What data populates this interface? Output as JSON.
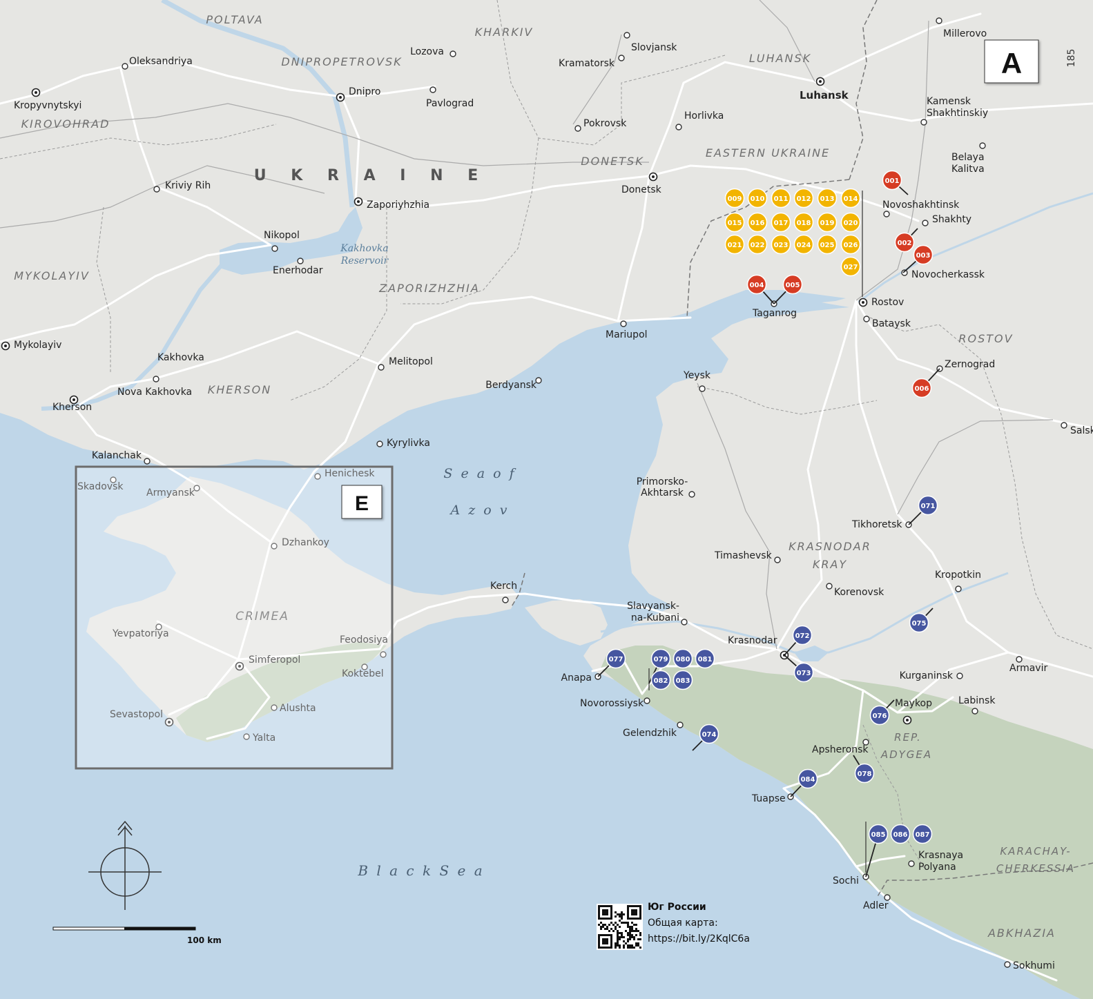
{
  "page_number": "185",
  "map_letter": "A",
  "inset_letter": "E",
  "countries": [
    {
      "id": "ukraine",
      "text": "U K R A I N E"
    }
  ],
  "regions": [
    {
      "id": "poltava",
      "text": "POLTAVA"
    },
    {
      "id": "kharkiv",
      "text": "KHARKIV"
    },
    {
      "id": "dnipropetrovsk",
      "text": "DNIPROPETROVSK"
    },
    {
      "id": "luhansk-region",
      "text": "LUHANSK"
    },
    {
      "id": "kirovohrad",
      "text": "KIROVOHRAD"
    },
    {
      "id": "eastern-ukraine",
      "text": "EASTERN UKRAINE"
    },
    {
      "id": "donetsk-region",
      "text": "DONETSK"
    },
    {
      "id": "mykolayiv-region",
      "text": "MYKOLAYIV"
    },
    {
      "id": "zaporizhzhia-region",
      "text": "ZAPORIZHZHIA"
    },
    {
      "id": "kherson-region",
      "text": "KHERSON"
    },
    {
      "id": "rostov-region",
      "text": "ROSTOV"
    },
    {
      "id": "krasnodar-1",
      "text": "KRASNODAR"
    },
    {
      "id": "krasnodar-2",
      "text": "KRAY"
    },
    {
      "id": "crimea",
      "text": "CRIMEA"
    },
    {
      "id": "adygea-1",
      "text": "REP."
    },
    {
      "id": "adygea-2",
      "text": "ADYGEA"
    },
    {
      "id": "karachay-1",
      "text": "KARACHAY-"
    },
    {
      "id": "karachay-2",
      "text": "CHERKESSIA"
    },
    {
      "id": "abkhazia",
      "text": "ABKHAZIA"
    }
  ],
  "water_labels": [
    {
      "id": "kakhovka-1",
      "text": "Kakhovka"
    },
    {
      "id": "kakhovka-2",
      "text": "Reservoir"
    },
    {
      "id": "azov-1",
      "text": "S e a   o f"
    },
    {
      "id": "azov-2",
      "text": "A z o v"
    },
    {
      "id": "black-sea",
      "text": "B  l  a  c  k     S  e  a"
    }
  ],
  "cities": [
    {
      "id": "millerovo",
      "name": "Millerovo"
    },
    {
      "id": "oleksandriya",
      "name": "Oleksandriya"
    },
    {
      "id": "lozova",
      "name": "Lozova"
    },
    {
      "id": "slovjansk",
      "name": "Slovjansk"
    },
    {
      "id": "kramatorsk",
      "name": "Kramatorsk"
    },
    {
      "id": "kropyvnytskyi",
      "name": "Kropyvnytskyi"
    },
    {
      "id": "dnipro",
      "name": "Dnipro"
    },
    {
      "id": "pavlograd",
      "name": "Pavlograd"
    },
    {
      "id": "luhansk",
      "name": "Luhansk"
    },
    {
      "id": "kamensk-1",
      "name": "Kamensk"
    },
    {
      "id": "kamensk-2",
      "name": "Shakhtinskiy"
    },
    {
      "id": "horlivka",
      "name": "Horlivka"
    },
    {
      "id": "pokrovsk",
      "name": "Pokrovsk"
    },
    {
      "id": "belaya-1",
      "name": "Belaya"
    },
    {
      "id": "belaya-2",
      "name": "Kalitva"
    },
    {
      "id": "kriviy-rih",
      "name": "Kriviy Rih"
    },
    {
      "id": "donetsk",
      "name": "Donetsk"
    },
    {
      "id": "zaporiyhzhia",
      "name": "Zaporiyhzhia"
    },
    {
      "id": "novoshakhtinsk",
      "name": "Novoshakhtinsk"
    },
    {
      "id": "shakhty",
      "name": "Shakhty"
    },
    {
      "id": "nikopol",
      "name": "Nikopol"
    },
    {
      "id": "enerhodar",
      "name": "Enerhodar"
    },
    {
      "id": "novocherkassk",
      "name": "Novocherkassk"
    },
    {
      "id": "taganrog",
      "name": "Taganrog"
    },
    {
      "id": "rostov",
      "name": "Rostov"
    },
    {
      "id": "bataysk",
      "name": "Bataysk"
    },
    {
      "id": "mariupol",
      "name": "Mariupol"
    },
    {
      "id": "mykolayiv",
      "name": "Mykolayiv"
    },
    {
      "id": "kakhovka",
      "name": "Kakhovka"
    },
    {
      "id": "melitopol",
      "name": "Melitopol"
    },
    {
      "id": "zernograd",
      "name": "Zernograd"
    },
    {
      "id": "nova-kakhovka",
      "name": "Nova Kakhovka"
    },
    {
      "id": "berdyansk",
      "name": "Berdyansk"
    },
    {
      "id": "yeysk",
      "name": "Yeysk"
    },
    {
      "id": "kherson",
      "name": "Kherson"
    },
    {
      "id": "salsk",
      "name": "Salsk"
    },
    {
      "id": "kyrylivka",
      "name": "Kyrylivka"
    },
    {
      "id": "kalanchak",
      "name": "Kalanchak"
    },
    {
      "id": "henichesk",
      "name": "Henichesk"
    },
    {
      "id": "skadovsk",
      "name": "Skadovsk"
    },
    {
      "id": "primorsko-1",
      "name": "Primorsko-"
    },
    {
      "id": "primorsko-2",
      "name": "Akhtarsk"
    },
    {
      "id": "armyansk",
      "name": "Armyansk"
    },
    {
      "id": "tikhoretsk",
      "name": "Tikhoretsk"
    },
    {
      "id": "dzhankoy",
      "name": "Dzhankoy"
    },
    {
      "id": "timashevsk",
      "name": "Timashevsk"
    },
    {
      "id": "kropotkin",
      "name": "Kropotkin"
    },
    {
      "id": "kerch",
      "name": "Kerch"
    },
    {
      "id": "korenovsk",
      "name": "Korenovsk"
    },
    {
      "id": "slavyansk-1",
      "name": "Slavyansk-"
    },
    {
      "id": "slavyansk-2",
      "name": "na-Kubani"
    },
    {
      "id": "yevpatoriya",
      "name": "Yevpatoriya"
    },
    {
      "id": "feodosiya",
      "name": "Feodosiya"
    },
    {
      "id": "krasnodar",
      "name": "Krasnodar"
    },
    {
      "id": "simferopol",
      "name": "Simferopol"
    },
    {
      "id": "armavir",
      "name": "Armavir"
    },
    {
      "id": "koktebel",
      "name": "Koktebel"
    },
    {
      "id": "anapa",
      "name": "Anapa"
    },
    {
      "id": "kurganinsk",
      "name": "Kurganinsk"
    },
    {
      "id": "labinsk",
      "name": "Labinsk"
    },
    {
      "id": "novorossiysk",
      "name": "Novorossiysk"
    },
    {
      "id": "maykop",
      "name": "Maykop"
    },
    {
      "id": "sevastopol",
      "name": "Sevastopol"
    },
    {
      "id": "alushta",
      "name": "Alushta"
    },
    {
      "id": "gelendzhik",
      "name": "Gelendzhik"
    },
    {
      "id": "yalta",
      "name": "Yalta"
    },
    {
      "id": "apsheronsk",
      "name": "Apsheronsk"
    },
    {
      "id": "tuapse",
      "name": "Tuapse"
    },
    {
      "id": "krasnaya-1",
      "name": "Krasnaya"
    },
    {
      "id": "krasnaya-2",
      "name": "Polyana"
    },
    {
      "id": "sochi",
      "name": "Sochi"
    },
    {
      "id": "adler",
      "name": "Adler"
    },
    {
      "id": "sokhumi",
      "name": "Sokhumi"
    }
  ],
  "markers": {
    "red": [
      "001",
      "002",
      "003",
      "004",
      "005",
      "006"
    ],
    "yellow": [
      "009",
      "010",
      "011",
      "012",
      "013",
      "014",
      "015",
      "016",
      "017",
      "018",
      "019",
      "020",
      "021",
      "022",
      "023",
      "024",
      "025",
      "026",
      "027"
    ],
    "blue": [
      "071",
      "072",
      "073",
      "074",
      "075",
      "076",
      "077",
      "078",
      "079",
      "080",
      "081",
      "082",
      "083",
      "084",
      "085",
      "086",
      "087"
    ]
  },
  "marker_colors": {
    "red": "#d63c24",
    "yellow": "#f2b400",
    "blue": "#4656a0"
  },
  "colors": {
    "sea": "#bfd6e8",
    "land": "#e6e6e3",
    "mountains": "#c5d3bd"
  },
  "scale_label": "100 km",
  "qr_note": {
    "title": "Юг России",
    "line1": "Общая карта:",
    "url": "https://bit.ly/2KqlC6a"
  }
}
